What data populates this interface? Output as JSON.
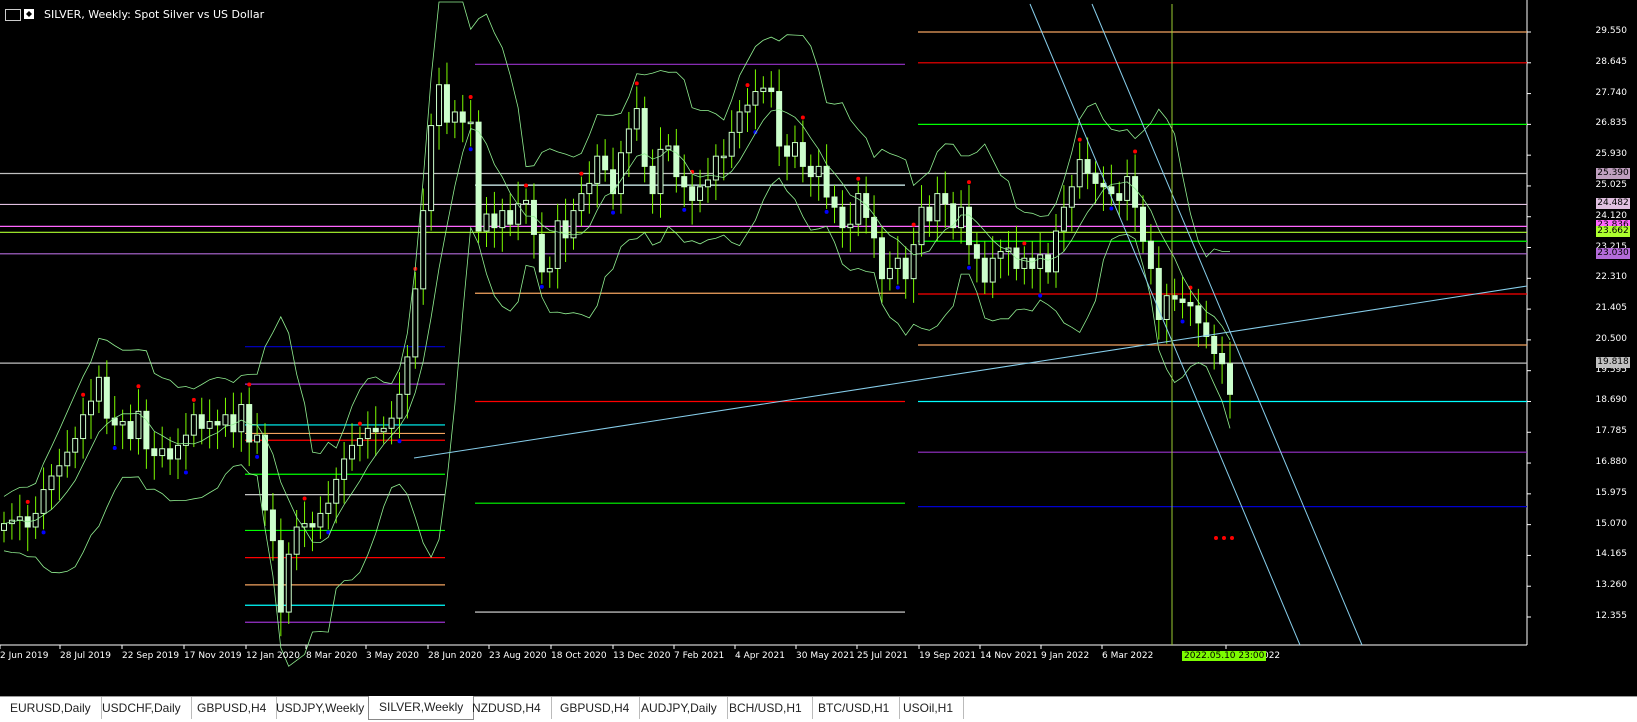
{
  "window": {
    "title": "SILVER, Weekly:  Spot Silver vs US Dollar"
  },
  "price_axis": [
    "29.550",
    "28.645",
    "27.740",
    "26.835",
    "25.930",
    "25.025",
    "24.120",
    "23.215",
    "22.310",
    "21.405",
    "20.500",
    "19.595",
    "18.690",
    "17.785",
    "16.880",
    "15.975",
    "15.070",
    "14.165",
    "13.260",
    "12.355"
  ],
  "price_tags": [
    {
      "text": "25.390",
      "color": "#c0a0c0"
    },
    {
      "text": "24.482",
      "color": "#e0c0e0"
    },
    {
      "text": "23.836",
      "color": "#ff66ff"
    },
    {
      "text": "23.662",
      "color": "#adff2f"
    },
    {
      "text": "23.030",
      "color": "#b36bd9"
    },
    {
      "text": "19.818",
      "color": "#c0c0c0"
    }
  ],
  "date_axis": [
    "2 Jun 2019",
    "28 Jul 2019",
    "22 Sep 2019",
    "17 Nov 2019",
    "12 Jan 2020",
    "8 Mar 2020",
    "3 May 2020",
    "28 Jun 2020",
    "23 Aug 2020",
    "18 Oct 2020",
    "13 Dec 2020",
    "7 Feb 2021",
    "4 Apr 2021",
    "30 May 2021",
    "25 Jul 2021",
    "19 Sep 2021",
    "14 Nov 2021",
    "9 Jan 2022",
    "6 Mar 2022",
    "26 Jun 2022"
  ],
  "crosshair_date": "2022.05.10 23:00",
  "tabs": [
    {
      "label": "EURUSD,Daily",
      "active": false
    },
    {
      "label": "USDCHF,Daily",
      "active": false
    },
    {
      "label": "GBPUSD,H4",
      "active": false
    },
    {
      "label": "USDJPY,Weekly",
      "active": false
    },
    {
      "label": "SILVER,Weekly",
      "active": true
    },
    {
      "label": "NZDUSD,H4",
      "active": false
    },
    {
      "label": "GBPUSD,H4",
      "active": false
    },
    {
      "label": "AUDJPY,Daily",
      "active": false
    },
    {
      "label": "BCH/USD,H1",
      "active": false
    },
    {
      "label": "BTC/USD,H1",
      "active": false
    },
    {
      "label": "USOil,H1",
      "active": false
    }
  ],
  "colors": {
    "background": "#000000",
    "candle": "#ccffcc",
    "bollinger": "#90ee90",
    "trendline": "#87ceeb",
    "fractal_up": "#ff0000",
    "fractal_down": "#0000ff"
  },
  "chart_data": {
    "type": "candlestick",
    "symbol": "SILVER",
    "timeframe": "Weekly",
    "closes": [
      15.1,
      15.2,
      15.3,
      15.0,
      15.4,
      16.1,
      16.5,
      16.8,
      17.2,
      17.6,
      18.3,
      18.7,
      19.4,
      18.2,
      18.0,
      18.1,
      17.6,
      18.4,
      17.3,
      17.1,
      17.3,
      17.0,
      17.4,
      17.7,
      18.3,
      17.9,
      18.1,
      18.0,
      18.3,
      17.8,
      18.6,
      17.5,
      17.7,
      15.5,
      14.6,
      12.5,
      14.2,
      15.0,
      15.1,
      15.0,
      15.4,
      15.7,
      16.4,
      17.0,
      17.4,
      17.6,
      17.9,
      17.8,
      17.9,
      18.2,
      18.9,
      20.0,
      22.0,
      24.3,
      26.8,
      28.0,
      26.9,
      27.2,
      26.9,
      26.9,
      23.7,
      24.2,
      23.8,
      24.3,
      23.9,
      24.5,
      24.6,
      23.6,
      22.5,
      22.6,
      24.0,
      23.5,
      24.3,
      24.8,
      25.1,
      25.9,
      25.5,
      24.8,
      26.0,
      26.7,
      27.3,
      25.6,
      24.8,
      26.1,
      26.2,
      25.3,
      25.0,
      24.6,
      25.0,
      25.2,
      25.9,
      25.9,
      26.6,
      27.2,
      27.4,
      27.8,
      27.9,
      27.8,
      26.2,
      25.9,
      26.3,
      25.6,
      25.3,
      25.6,
      24.7,
      24.4,
      23.8,
      23.9,
      24.8,
      24.1,
      23.5,
      22.3,
      22.6,
      22.9,
      22.3,
      23.3,
      24.4,
      24.0,
      24.8,
      24.5,
      23.8,
      24.4,
      23.3,
      22.9,
      22.2,
      22.9,
      23.1,
      23.2,
      22.6,
      22.9,
      22.6,
      23.0,
      22.5,
      23.7,
      24.4,
      25.0,
      25.8,
      25.4,
      25.1,
      25.0,
      24.8,
      24.6,
      25.3,
      24.4,
      23.4,
      22.6,
      21.1,
      21.8,
      21.7,
      21.6,
      21.5,
      21.0,
      20.6,
      20.1,
      19.8,
      18.9
    ],
    "price_range": [
      12.0,
      30.0
    ],
    "horizontal_levels": [
      {
        "price": 29.55,
        "color": "#f4a460"
      },
      {
        "price": 28.645,
        "color": "#ff0000"
      },
      {
        "price": 28.6,
        "color": "#9932cc"
      },
      {
        "price": 26.835,
        "color": "#00ff00"
      },
      {
        "price": 25.39,
        "color": "#c0c0c0"
      },
      {
        "price": 25.05,
        "color": "#e0ffff"
      },
      {
        "price": 24.482,
        "color": "#e0c0e0"
      },
      {
        "price": 23.836,
        "color": "#ff66ff"
      },
      {
        "price": 23.662,
        "color": "#adff2f"
      },
      {
        "price": 23.4,
        "color": "#00ff00"
      },
      {
        "price": 23.03,
        "color": "#b36bd9"
      },
      {
        "price": 21.85,
        "color": "#ff0000"
      },
      {
        "price": 21.87,
        "color": "#f4a460"
      },
      {
        "price": 20.35,
        "color": "#f4a460"
      },
      {
        "price": 19.818,
        "color": "#c0c0c0"
      },
      {
        "price": 18.69,
        "color": "#00ffff"
      },
      {
        "price": 17.2,
        "color": "#9932cc"
      },
      {
        "price": 15.6,
        "color": "#0000cd"
      }
    ]
  }
}
